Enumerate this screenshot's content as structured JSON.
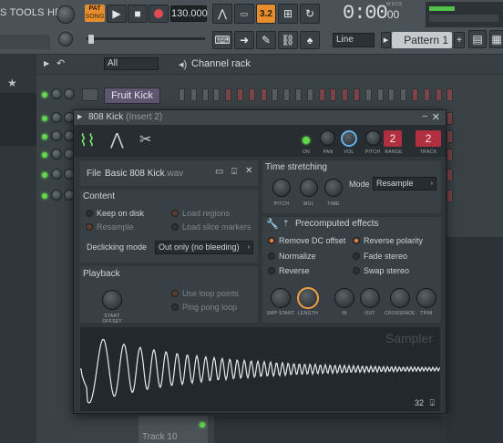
{
  "menu": {
    "text": "S TOOLS HELP"
  },
  "toolbar": {
    "pat_label": "PAT",
    "song_label": "SONG",
    "tempo": "130.000",
    "time": "0:00",
    "time_frac": "00",
    "time_unit": "M:S:CS",
    "snap": "Line",
    "pattern": "Pattern 1",
    "rec_label": "3.2"
  },
  "rack": {
    "filter": "All",
    "title": "Channel rack",
    "channel": "Fruit Kick",
    "track10": "Track 10"
  },
  "plugin": {
    "title": "808 Kick",
    "insert": "(Insert 2)",
    "header_knobs": {
      "on": "ON",
      "pan": "PAN",
      "vol": "VOL",
      "pitch": "PITCH",
      "range": "RANGE",
      "track": "TRACK",
      "range_val": "2",
      "track_val": "2"
    },
    "file": {
      "label": "File",
      "name": "Basic 808 Kick",
      "ext": ".wav"
    },
    "content": {
      "title": "Content",
      "keep": "Keep on disk",
      "resample": "Resample",
      "load_regions": "Load regions",
      "load_slice": "Load slice markers",
      "declick_label": "Declicking mode",
      "declick_value": "Out only (no bleeding)"
    },
    "playback": {
      "title": "Playback",
      "start": "START OFFSET",
      "loop": "Use loop points",
      "ping": "Ping pong loop"
    },
    "stretch": {
      "title": "Time stretching",
      "mode_label": "Mode",
      "mode_value": "Resample",
      "pitch": "PITCH",
      "mul": "MUL",
      "time": "TIME"
    },
    "effects": {
      "title": "Precomputed effects",
      "remove_dc": "Remove DC offset",
      "reverse_pol": "Reverse polarity",
      "normalize": "Normalize",
      "fade": "Fade stereo",
      "reverse": "Reverse",
      "swap": "Swap stereo",
      "knobs": [
        "SMP START",
        "LENGTH",
        "IN",
        "OUT",
        "CROSSFADE",
        "TRIM"
      ]
    },
    "sampler_label": "Sampler",
    "wave_bits": "32"
  },
  "colors": {
    "accent": "#e88d2c",
    "led": "#5fd84a",
    "red": "#b12f3e",
    "wave": "#e8ebec"
  },
  "icons": [
    "wave-tab-icon",
    "envelope-tab-icon",
    "tools-tab-icon",
    "folder-icon",
    "save-icon",
    "close-icon",
    "wrench-icon"
  ]
}
